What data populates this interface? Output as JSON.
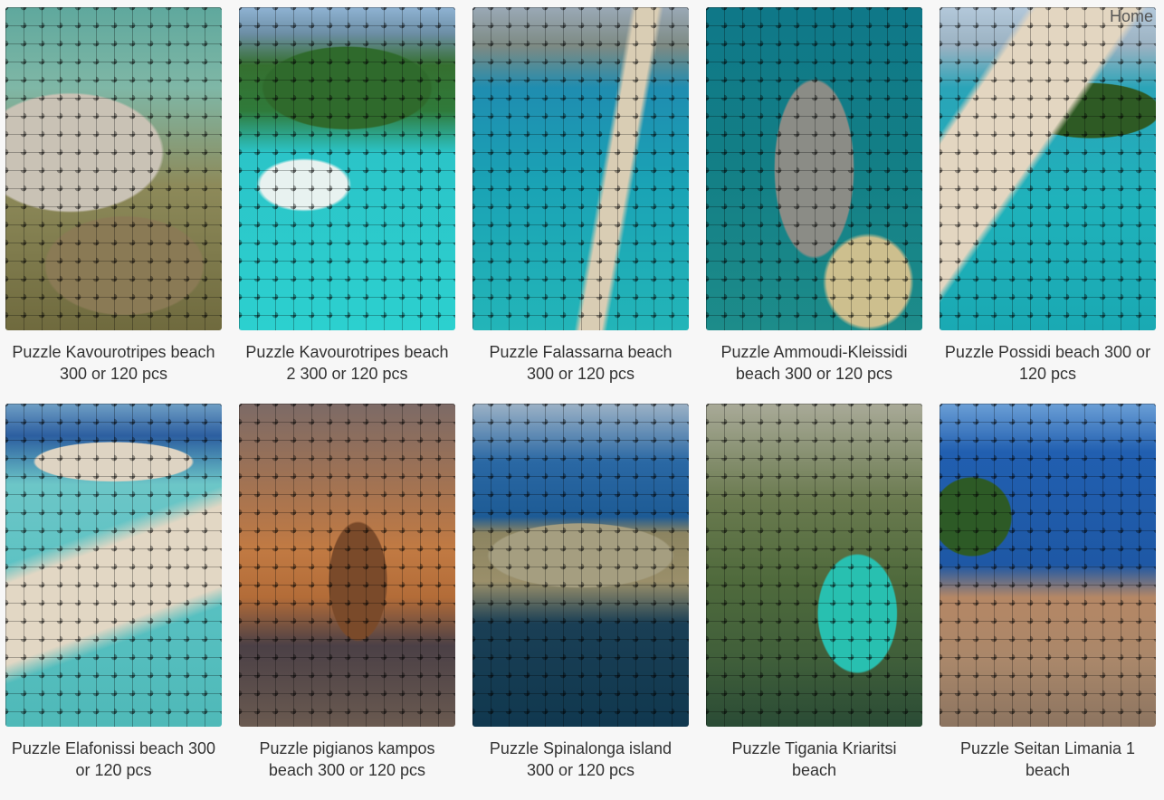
{
  "nav": {
    "home_label": "Home"
  },
  "products": [
    {
      "title": "Puzzle Kavourotripes beach 300 or 120 pcs",
      "scene": "s1"
    },
    {
      "title": "Puzzle Kavourotripes beach 2 300 or 120 pcs",
      "scene": "s2"
    },
    {
      "title": "Puzzle Falassarna beach 300 or 120 pcs",
      "scene": "s3"
    },
    {
      "title": "Puzzle Ammoudi-Kleissidi beach 300 or 120 pcs",
      "scene": "s4"
    },
    {
      "title": "Puzzle Possidi beach 300 or 120 pcs",
      "scene": "s5"
    },
    {
      "title": "Puzzle Elafonissi beach 300 or 120 pcs",
      "scene": "s6"
    },
    {
      "title": "Puzzle pigianos kampos beach 300 or 120 pcs",
      "scene": "s7"
    },
    {
      "title": "Puzzle Spinalonga island 300 or 120 pcs",
      "scene": "s8"
    },
    {
      "title": "Puzzle Tigania Kriaritsi beach",
      "scene": "s9"
    },
    {
      "title": "Puzzle Seitan Limania 1 beach",
      "scene": "s10"
    }
  ]
}
